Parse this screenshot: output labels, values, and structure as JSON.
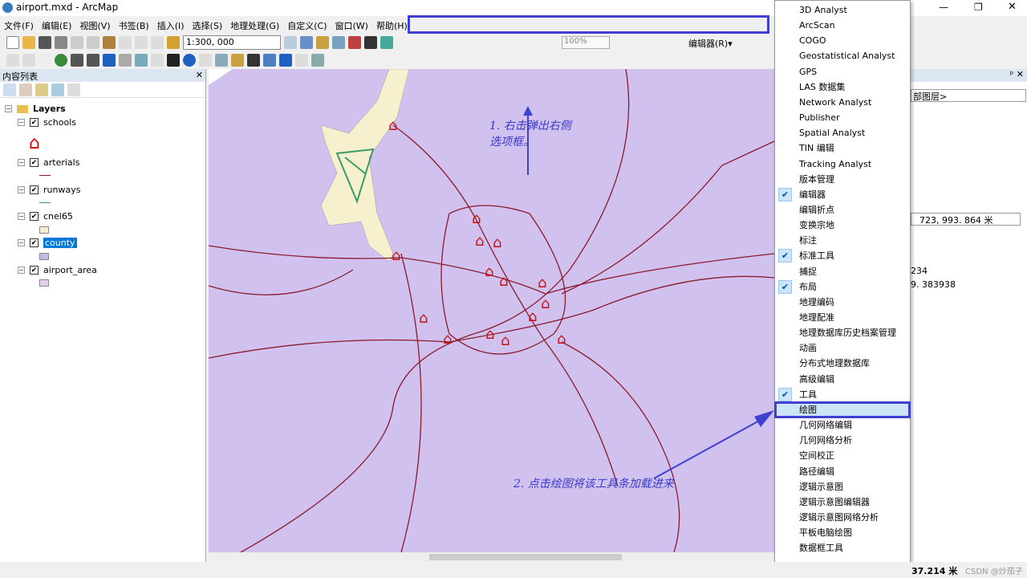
{
  "window": {
    "title": "airport.mxd - ArcMap"
  },
  "menubar": [
    "文件(F)",
    "编辑(E)",
    "视图(V)",
    "书签(B)",
    "插入(I)",
    "选择(S)",
    "地理处理(G)",
    "自定义(C)",
    "窗口(W)",
    "帮助(H)"
  ],
  "toolbar": {
    "scale": "1:300, 000",
    "zoom": "100%",
    "editor": "编辑器(R)▾"
  },
  "toc": {
    "title": "内容列表",
    "root": "Layers",
    "layers": [
      {
        "name": "schools",
        "checked": true
      },
      {
        "name": "arterials",
        "checked": true
      },
      {
        "name": "runways",
        "checked": true
      },
      {
        "name": "cnel65",
        "checked": true
      },
      {
        "name": "county",
        "checked": true,
        "selected": true
      },
      {
        "name": "airport_area",
        "checked": true
      }
    ]
  },
  "menu": {
    "items": [
      {
        "label": "3D Analyst",
        "checked": false
      },
      {
        "label": "ArcScan",
        "checked": false
      },
      {
        "label": "COGO",
        "checked": false
      },
      {
        "label": "Geostatistical Analyst",
        "checked": false
      },
      {
        "label": "GPS",
        "checked": false
      },
      {
        "label": "LAS 数据集",
        "checked": false
      },
      {
        "label": "Network Analyst",
        "checked": false
      },
      {
        "label": "Publisher",
        "checked": false
      },
      {
        "label": "Spatial Analyst",
        "checked": false
      },
      {
        "label": "TIN 编辑",
        "checked": false
      },
      {
        "label": "Tracking Analyst",
        "checked": false
      },
      {
        "label": "版本管理",
        "checked": false
      },
      {
        "label": "编辑器",
        "checked": true
      },
      {
        "label": "编辑折点",
        "checked": false
      },
      {
        "label": "变换宗地",
        "checked": false
      },
      {
        "label": "标注",
        "checked": false
      },
      {
        "label": "标准工具",
        "checked": true
      },
      {
        "label": "捕捉",
        "checked": false
      },
      {
        "label": "布局",
        "checked": true
      },
      {
        "label": "地理编码",
        "checked": false
      },
      {
        "label": "地理配准",
        "checked": false
      },
      {
        "label": "地理数据库历史档案管理",
        "checked": false
      },
      {
        "label": "动画",
        "checked": false
      },
      {
        "label": "分布式地理数据库",
        "checked": false
      },
      {
        "label": "高级编辑",
        "checked": false
      },
      {
        "label": "工具",
        "checked": true
      },
      {
        "label": "绘图",
        "checked": false,
        "highlighted": true
      },
      {
        "label": "几何网络编辑",
        "checked": false
      },
      {
        "label": "几何网络分析",
        "checked": false
      },
      {
        "label": "空间校正",
        "checked": false
      },
      {
        "label": "路径编辑",
        "checked": false
      },
      {
        "label": "逻辑示意图",
        "checked": false
      },
      {
        "label": "逻辑示意图编辑器",
        "checked": false
      },
      {
        "label": "逻辑示意图网络分析",
        "checked": false
      },
      {
        "label": "平板电脑绘图",
        "checked": false
      },
      {
        "label": "数据框工具",
        "checked": false
      }
    ]
  },
  "right": {
    "combo": "部图层>",
    "coord": "723, 993. 864 米",
    "v1": "234",
    "v2": "9. 383938"
  },
  "status": {
    "coord": "37.214 米",
    "watermark": "CSDN @炒茄子"
  },
  "annotations": {
    "a1": "1. 右击弹出右侧\n选项框。",
    "a2": "2. 点击绘图将该工具条加载进来"
  },
  "colors": {
    "map": "#d0c1ef",
    "road": "#8b1a2b",
    "highlight": "#4040d0"
  }
}
